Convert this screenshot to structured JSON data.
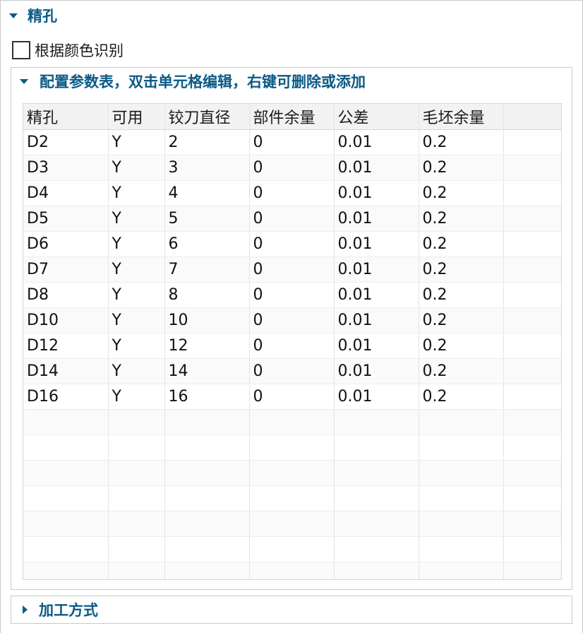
{
  "main_section": {
    "title": "精孔",
    "expanded": true
  },
  "color_recognition": {
    "label": "根据颜色识别",
    "checked": false
  },
  "config_section": {
    "title": "配置参数表，双击单元格编辑，右键可删除或添加",
    "expanded": true
  },
  "table": {
    "columns": [
      "精孔",
      "可用",
      "铰刀直径",
      "部件余量",
      "公差",
      "毛坯余量"
    ],
    "rows": [
      [
        "D2",
        "Y",
        "2",
        "0",
        "0.01",
        "0.2"
      ],
      [
        "D3",
        "Y",
        "3",
        "0",
        "0.01",
        "0.2"
      ],
      [
        "D4",
        "Y",
        "4",
        "0",
        "0.01",
        "0.2"
      ],
      [
        "D5",
        "Y",
        "5",
        "0",
        "0.01",
        "0.2"
      ],
      [
        "D6",
        "Y",
        "6",
        "0",
        "0.01",
        "0.2"
      ],
      [
        "D7",
        "Y",
        "7",
        "0",
        "0.01",
        "0.2"
      ],
      [
        "D8",
        "Y",
        "8",
        "0",
        "0.01",
        "0.2"
      ],
      [
        "D10",
        "Y",
        "10",
        "0",
        "0.01",
        "0.2"
      ],
      [
        "D12",
        "Y",
        "12",
        "0",
        "0.01",
        "0.2"
      ],
      [
        "D14",
        "Y",
        "14",
        "0",
        "0.01",
        "0.2"
      ],
      [
        "D16",
        "Y",
        "16",
        "0",
        "0.01",
        "0.2"
      ]
    ]
  },
  "machining_section": {
    "title": "加工方式",
    "expanded": false
  },
  "colors": {
    "section_title": "#0b5a86",
    "border": "#c9c9c9",
    "header_bg": "#f2f2f2"
  }
}
